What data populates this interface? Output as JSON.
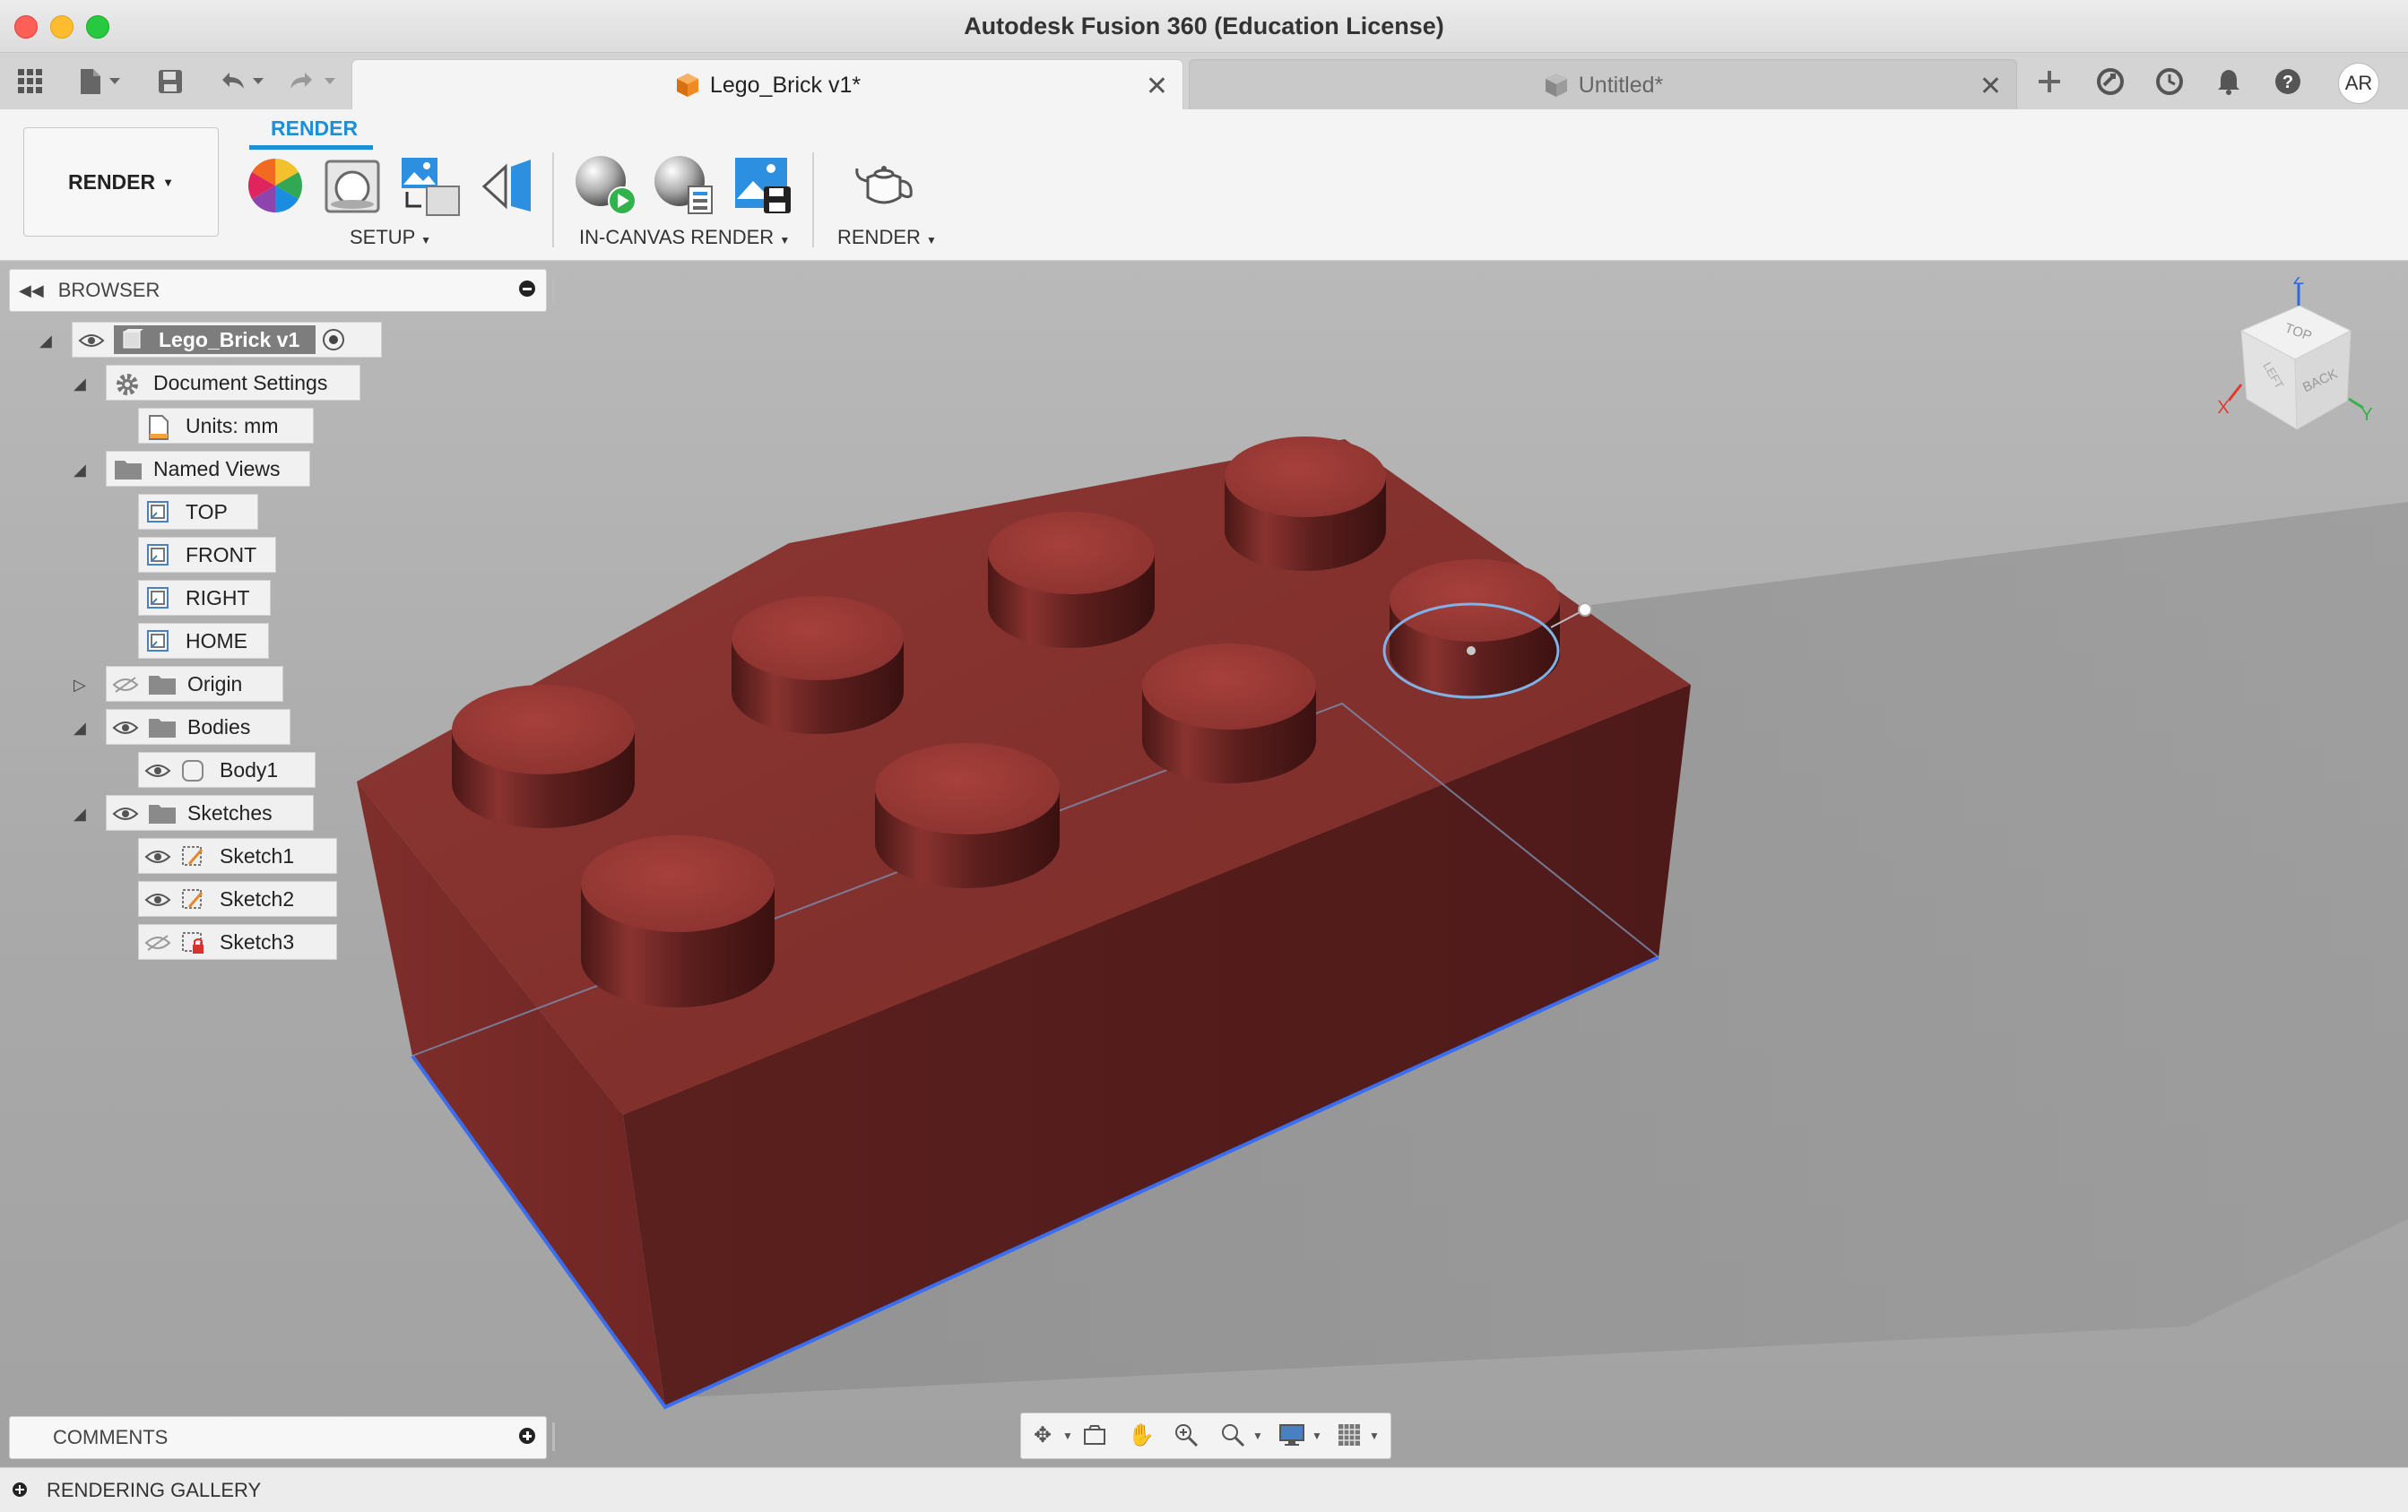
{
  "window": {
    "title": "Autodesk Fusion 360 (Education License)"
  },
  "tabs": [
    {
      "label": "Lego_Brick v1*",
      "active": true
    },
    {
      "label": "Untitled*",
      "active": false
    }
  ],
  "user": {
    "initials": "AR"
  },
  "toolbar": {
    "workspace_label": "RENDER",
    "active_tab": "RENDER",
    "groups": [
      {
        "label": "SETUP",
        "icons": [
          "appearance-icon",
          "scene-settings-icon",
          "texture-map-icon",
          "decal-icon"
        ]
      },
      {
        "label": "IN-CANVAS RENDER",
        "icons": [
          "in-canvas-render-icon",
          "in-canvas-settings-icon",
          "capture-image-icon"
        ]
      },
      {
        "label": "RENDER",
        "icons": [
          "render-teapot-icon"
        ]
      }
    ]
  },
  "browser": {
    "title": "BROWSER",
    "root": "Lego_Brick v1",
    "document_settings": "Document Settings",
    "units": "Units: mm",
    "named_views": "Named Views",
    "views": [
      "TOP",
      "FRONT",
      "RIGHT",
      "HOME"
    ],
    "origin": "Origin",
    "bodies": "Bodies",
    "body1": "Body1",
    "sketches": "Sketches",
    "sketch_items": [
      "Sketch1",
      "Sketch2",
      "Sketch3"
    ]
  },
  "comments": {
    "title": "COMMENTS"
  },
  "statusbar": {
    "label": "RENDERING GALLERY"
  },
  "viewcube": {
    "faces": [
      "TOP",
      "BACK",
      "LEFT"
    ],
    "axes": [
      "Z",
      "X",
      "Y"
    ]
  },
  "colors": {
    "brick": "#7a2a28",
    "accent": "#1c8fd6",
    "edge_highlight": "#3b6df0"
  }
}
